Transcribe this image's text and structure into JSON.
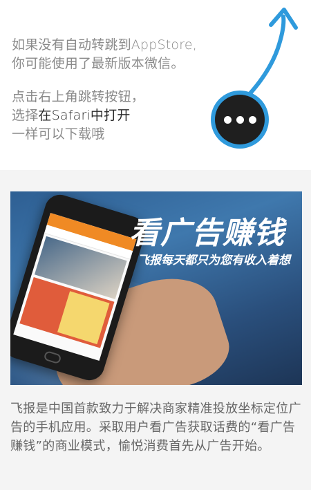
{
  "guide": {
    "line1": "如果没有自动转跳到AppStore,",
    "line2": "你可能使用了最新版本微信。",
    "line3": "点击右上角跳转按钮，",
    "line4_prefix": "选择",
    "line4_strong": "在Safari中打开",
    "line5": "一样可以下载哦"
  },
  "banner": {
    "title": "看广告赚钱",
    "subtitle": "飞报每天都只为您有收入着想"
  },
  "description": "飞报是中国首款致力于解决商家精准投放坐标定位广告的手机应用。采取用户看广告获取话费的“看广告赚钱”的商业模式，愉悦消费首先从广告开始。",
  "colors": {
    "accent": "#2f9adc",
    "button_bg": "#1f1f1f",
    "text": "#8a8a8a",
    "strong_text": "#2a2a2a"
  }
}
